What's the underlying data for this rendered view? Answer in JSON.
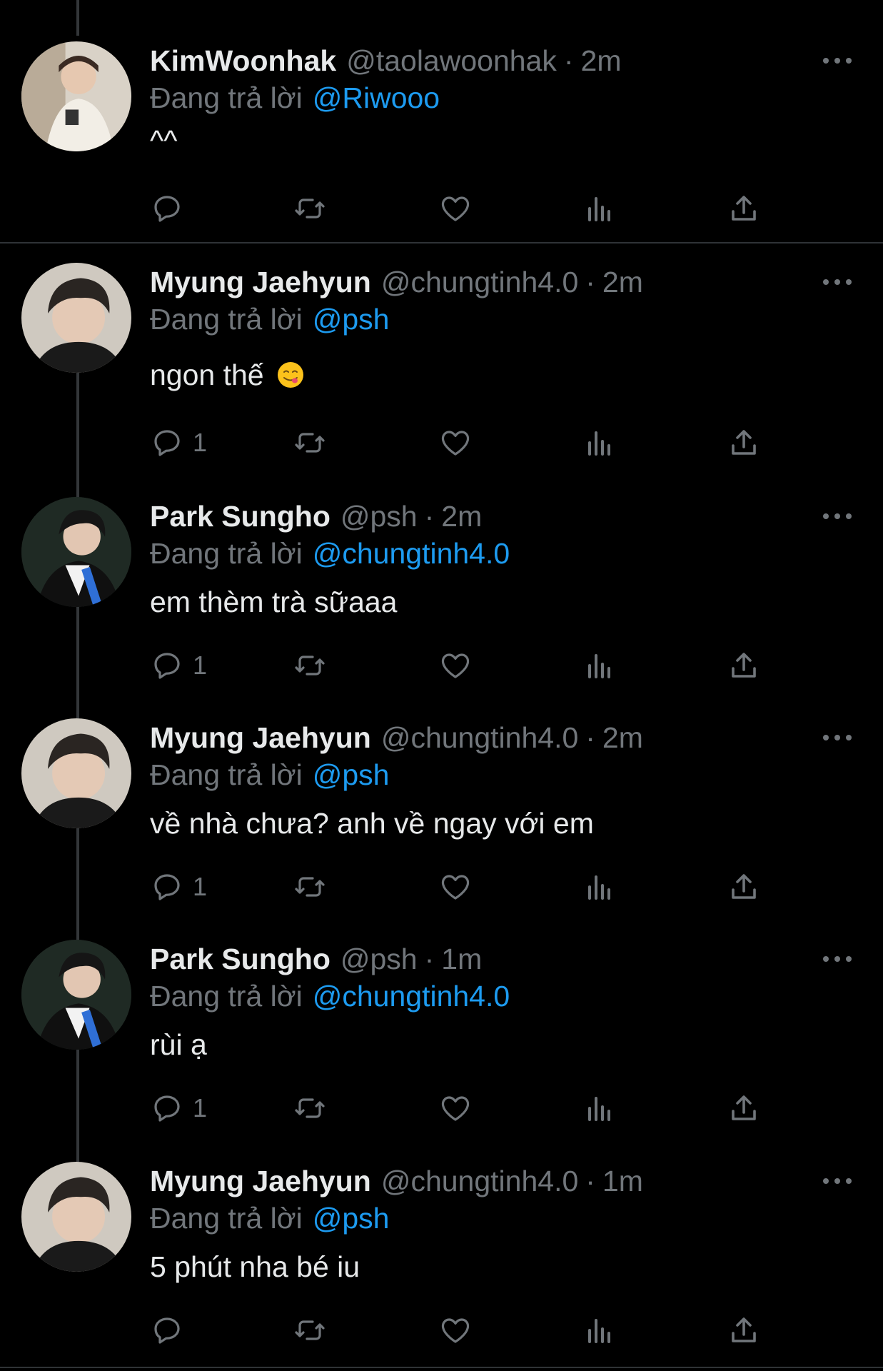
{
  "reply_prefix": "Đang trả lời",
  "tweets": [
    {
      "name": "KimWoonhak",
      "handle": "@taolawoonhak",
      "time": "2m",
      "reply_to": "@Riwooo",
      "text": "^^",
      "reply_count": ""
    },
    {
      "name": "Myung Jaehyun",
      "handle": "@chungtinh4.0",
      "time": "2m",
      "reply_to": "@psh",
      "text": "ngon thế",
      "emoji": "face-savoring-food",
      "reply_count": "1"
    },
    {
      "name": "Park Sungho",
      "handle": "@psh",
      "time": "2m",
      "reply_to": "@chungtinh4.0",
      "text": "em thèm trà sữaaa",
      "reply_count": "1"
    },
    {
      "name": "Myung Jaehyun",
      "handle": "@chungtinh4.0",
      "time": "2m",
      "reply_to": "@psh",
      "text": "về nhà chưa? anh về ngay với em",
      "reply_count": "1"
    },
    {
      "name": "Park Sungho",
      "handle": "@psh",
      "time": "1m",
      "reply_to": "@chungtinh4.0",
      "text": "rùi ạ",
      "reply_count": "1"
    },
    {
      "name": "Myung Jaehyun",
      "handle": "@chungtinh4.0",
      "time": "1m",
      "reply_to": "@psh",
      "text": "5 phút nha bé iu",
      "reply_count": ""
    }
  ],
  "colors": {
    "background": "#000000",
    "text": "#e7e9ea",
    "muted": "#71767b",
    "link": "#1d9bf0",
    "divider": "#2f3336"
  },
  "icons": [
    "reply-icon",
    "retweet-icon",
    "like-icon",
    "views-icon",
    "share-icon",
    "more-icon"
  ]
}
